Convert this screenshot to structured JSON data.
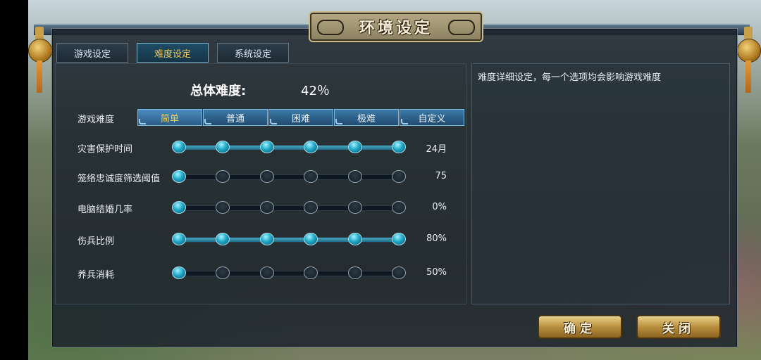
{
  "window": {
    "title": "环境设定"
  },
  "tabs": [
    {
      "label": "游戏设定",
      "active": false
    },
    {
      "label": "难度设定",
      "active": true
    },
    {
      "label": "系统设定",
      "active": false
    }
  ],
  "overall": {
    "label": "总体难度:",
    "value": "42％"
  },
  "difficulty": {
    "label": "游戏难度",
    "options": [
      "简单",
      "普通",
      "困难",
      "极难",
      "自定义"
    ],
    "selected_index": 0
  },
  "sliders": [
    {
      "label": "灾害保护时间",
      "value_text": "24月",
      "level": 6,
      "steps": 6
    },
    {
      "label": "笼络忠诚度筛选阈值",
      "value_text": "75",
      "level": 1,
      "steps": 6
    },
    {
      "label": "电脑结婚几率",
      "value_text": "0%",
      "level": 1,
      "steps": 6
    },
    {
      "label": "伤兵比例",
      "value_text": "80%",
      "level": 6,
      "steps": 6
    },
    {
      "label": "养兵消耗",
      "value_text": "50%",
      "level": 1,
      "steps": 6
    }
  ],
  "description": {
    "text": "难度详细设定，每一个选项均会影响游戏难度"
  },
  "buttons": {
    "confirm": "确定",
    "close": "关闭"
  },
  "colors": {
    "accent_gold": "#f0c85a",
    "slider_on": "#1fa9c8",
    "button_gold": "#b48a3a"
  }
}
